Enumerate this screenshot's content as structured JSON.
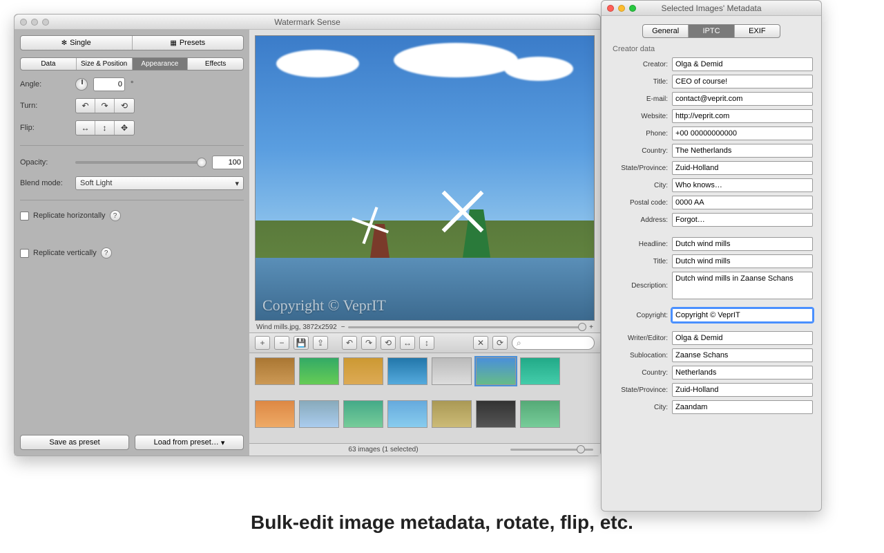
{
  "main": {
    "title": "Watermark Sense",
    "mode_tabs": {
      "single": "Single",
      "presets": "Presets"
    },
    "sub_tabs": {
      "data": "Data",
      "size": "Size & Position",
      "appearance": "Appearance",
      "effects": "Effects",
      "active": "Appearance"
    },
    "angle": {
      "label": "Angle:",
      "value": "0",
      "unit": "°"
    },
    "turn": {
      "label": "Turn:"
    },
    "flip": {
      "label": "Flip:"
    },
    "opacity": {
      "label": "Opacity:",
      "value": "100"
    },
    "blend": {
      "label": "Blend mode:",
      "value": "Soft Light"
    },
    "rep_h": "Replicate horizontally",
    "rep_v": "Replicate vertically",
    "save_preset": "Save as preset",
    "load_preset": "Load from preset…",
    "watermark_text": "Copyright © VeprIT",
    "file_info": "Wind mills.jpg,  3872x2592",
    "status": "63 images (1 selected)"
  },
  "meta": {
    "title": "Selected Images' Metadata",
    "tabs": {
      "general": "General",
      "iptc": "IPTC",
      "exif": "EXIF"
    },
    "group1": "Creator data",
    "creator": {
      "label": "Creator:",
      "value": "Olga & Demid"
    },
    "ctitle": {
      "label": "Title:",
      "value": "CEO of course!"
    },
    "email": {
      "label": "E-mail:",
      "value": "contact@veprit.com"
    },
    "website": {
      "label": "Website:",
      "value": "http://veprit.com"
    },
    "phone": {
      "label": "Phone:",
      "value": "+00 00000000000"
    },
    "country": {
      "label": "Country:",
      "value": "The Netherlands"
    },
    "state": {
      "label": "State/Province:",
      "value": "Zuid-Holland"
    },
    "city": {
      "label": "City:",
      "value": "Who knows…"
    },
    "postal": {
      "label": "Postal code:",
      "value": "0000 AA"
    },
    "address": {
      "label": "Address:",
      "value": "Forgot…"
    },
    "headline": {
      "label": "Headline:",
      "value": "Dutch wind mills"
    },
    "title2": {
      "label": "Title:",
      "value": "Dutch wind mills"
    },
    "desc": {
      "label": "Description:",
      "value": "Dutch wind mills in Zaanse Schans"
    },
    "copyright": {
      "label": "Copyright:",
      "value": "Copyright © VeprIT"
    },
    "writer": {
      "label": "Writer/Editor:",
      "value": "Olga & Demid"
    },
    "subloc": {
      "label": "Sublocation:",
      "value": "Zaanse Schans"
    },
    "country2": {
      "label": "Country:",
      "value": "Netherlands"
    },
    "state2": {
      "label": "State/Province:",
      "value": "Zuid-Holland"
    },
    "city2": {
      "label": "City:",
      "value": "Zaandam"
    }
  },
  "caption": "Bulk-edit image metadata, rotate, flip, etc."
}
